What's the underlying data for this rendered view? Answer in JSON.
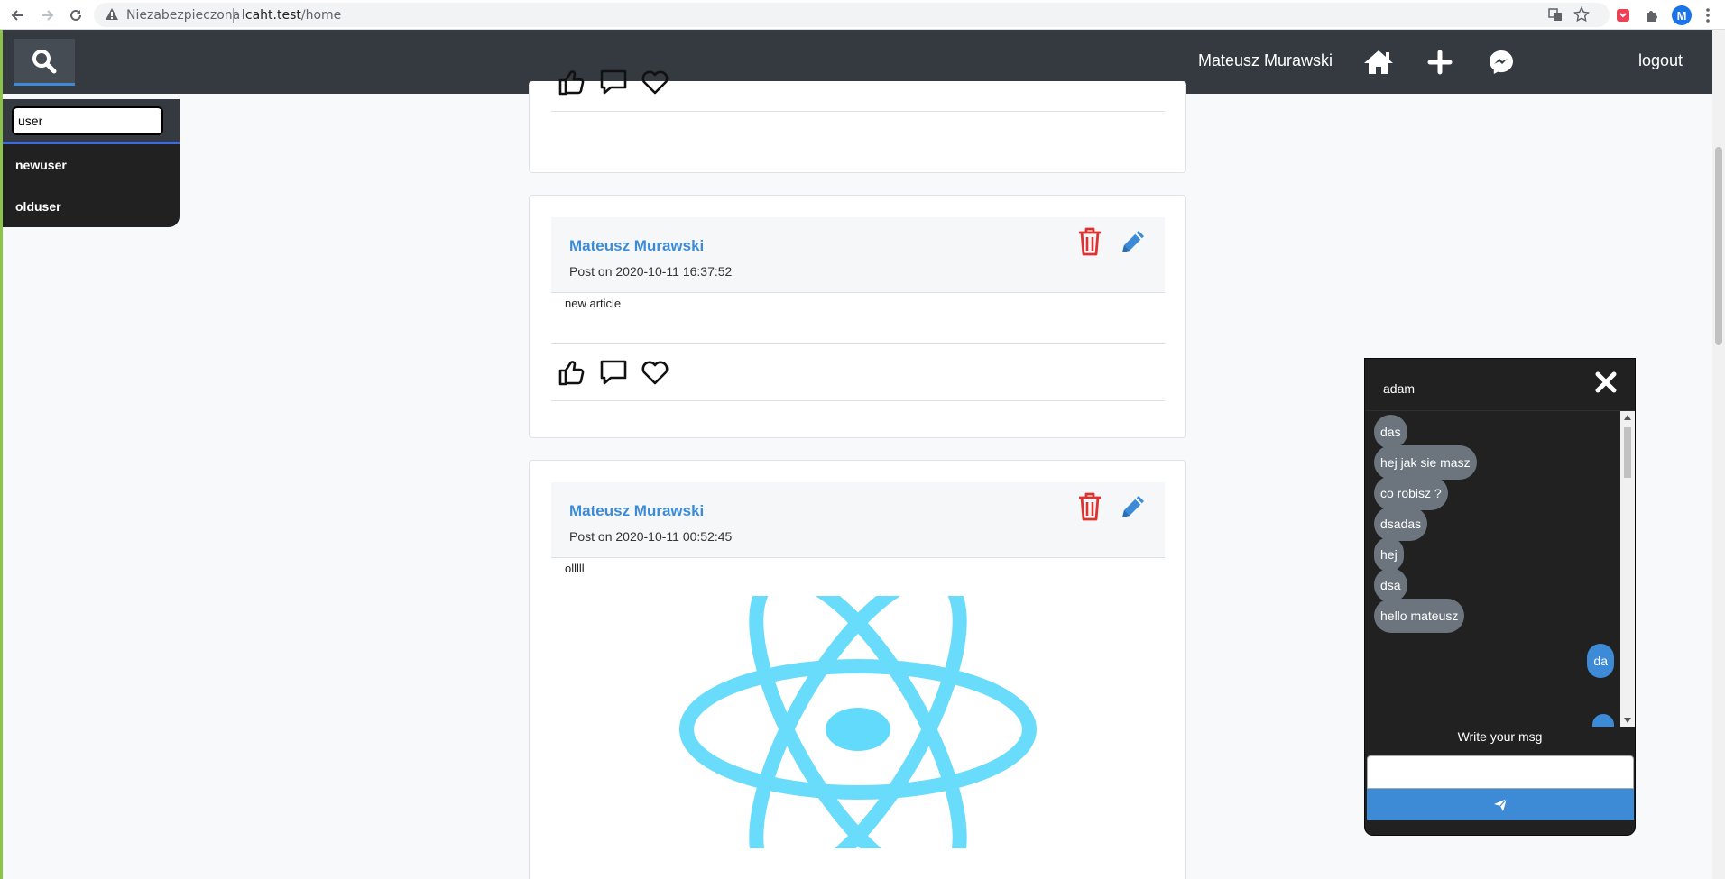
{
  "browser": {
    "insecure_label": "Niezabezpieczona",
    "url_host": "lcaht.test",
    "url_path": "/home",
    "profile_initial": "M"
  },
  "navbar": {
    "user_name": "Mateusz Murawski",
    "logout_label": "logout",
    "icons": [
      "search-icon",
      "home-icon",
      "plus-icon",
      "messenger-icon"
    ]
  },
  "search": {
    "query": "user",
    "results": [
      "newuser",
      "olduser"
    ]
  },
  "posts": [
    {
      "author": "Mateusz Murawski",
      "date": "Post on 2020-10-11 16:37:52",
      "text": "new article"
    },
    {
      "author": "Mateusz Murawski",
      "date": "Post on 2020-10-11 00:52:45",
      "text": "olllll",
      "image": "react-logo"
    }
  ],
  "chat": {
    "contact": "adam",
    "messages": [
      {
        "text": "das",
        "from": "them"
      },
      {
        "text": "hej jak sie masz",
        "from": "them"
      },
      {
        "text": "co robisz ?",
        "from": "them"
      },
      {
        "text": "dsadas",
        "from": "them"
      },
      {
        "text": "hej",
        "from": "them"
      },
      {
        "text": "dsa",
        "from": "them"
      },
      {
        "text": "hello mateusz",
        "from": "them"
      },
      {
        "text": "da",
        "from": "me"
      }
    ],
    "write_label": "Write your msg",
    "input_value": ""
  },
  "colors": {
    "navbar": "#343a40",
    "accent": "#3d8bd6",
    "danger": "#e03131",
    "react": "#61dafb"
  }
}
